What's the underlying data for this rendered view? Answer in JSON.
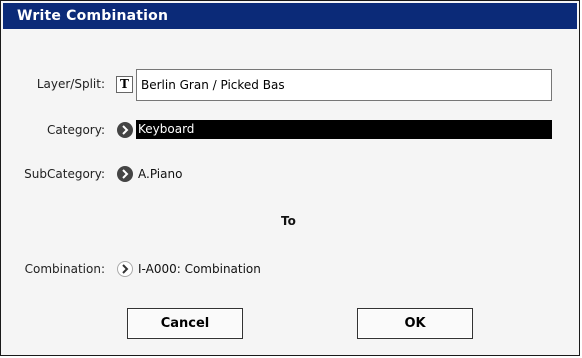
{
  "dialog": {
    "title": "Write Combination"
  },
  "layer_split": {
    "label": "Layer/Split:",
    "text_edit_glyph": "T",
    "value": "Berlin Gran / Picked Bas"
  },
  "category": {
    "label": "Category:",
    "value": "Keyboard"
  },
  "subcategory": {
    "label": "SubCategory:",
    "value": "A.Piano"
  },
  "to_label": "To",
  "combination": {
    "label": "Combination:",
    "value": "I-A000: Combination"
  },
  "buttons": {
    "cancel": "Cancel",
    "ok": "OK"
  },
  "colors": {
    "titlebar": "#0b2a78",
    "selection": "#000000",
    "background": "#f5f5f5"
  }
}
